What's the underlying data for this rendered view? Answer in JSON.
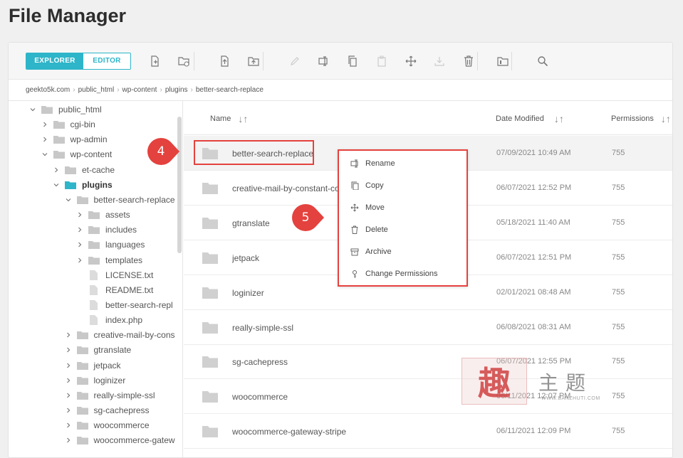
{
  "page": {
    "title": "File Manager"
  },
  "toolbar": {
    "explorer_label": "EXPLORER",
    "editor_label": "EDITOR",
    "accent": "#2eb5c9",
    "icons": [
      "new-file-icon",
      "new-folder-icon",
      "upload-file-icon",
      "upload-folder-icon",
      "edit-icon",
      "rename-icon",
      "copy-icon",
      "paste-icon",
      "move-icon",
      "extract-icon",
      "delete-icon",
      "archive-folder-icon",
      "search-icon"
    ]
  },
  "breadcrumb": [
    "geekto5k.com",
    "public_html",
    "wp-content",
    "plugins",
    "better-search-replace"
  ],
  "tree": [
    {
      "label": "public_html",
      "type": "folder",
      "depth": 0,
      "expanded": true
    },
    {
      "label": "cgi-bin",
      "type": "folder",
      "depth": 1,
      "expanded": false
    },
    {
      "label": "wp-admin",
      "type": "folder",
      "depth": 1,
      "expanded": false
    },
    {
      "label": "wp-content",
      "type": "folder",
      "depth": 1,
      "expanded": true
    },
    {
      "label": "et-cache",
      "type": "folder",
      "depth": 2,
      "expanded": false
    },
    {
      "label": "plugins",
      "type": "folder",
      "depth": 2,
      "expanded": true,
      "active": true
    },
    {
      "label": "better-search-replace",
      "type": "folder",
      "depth": 3,
      "expanded": true
    },
    {
      "label": "assets",
      "type": "folder",
      "depth": 4,
      "expanded": false
    },
    {
      "label": "includes",
      "type": "folder",
      "depth": 4,
      "expanded": false
    },
    {
      "label": "languages",
      "type": "folder",
      "depth": 4,
      "expanded": false
    },
    {
      "label": "templates",
      "type": "folder",
      "depth": 4,
      "expanded": false
    },
    {
      "label": "LICENSE.txt",
      "type": "file",
      "depth": 4
    },
    {
      "label": "README.txt",
      "type": "file",
      "depth": 4
    },
    {
      "label": "better-search-repl",
      "type": "file",
      "depth": 4
    },
    {
      "label": "index.php",
      "type": "file",
      "depth": 4
    },
    {
      "label": "creative-mail-by-cons",
      "type": "folder",
      "depth": 3,
      "expanded": false
    },
    {
      "label": "gtranslate",
      "type": "folder",
      "depth": 3,
      "expanded": false
    },
    {
      "label": "jetpack",
      "type": "folder",
      "depth": 3,
      "expanded": false
    },
    {
      "label": "loginizer",
      "type": "folder",
      "depth": 3,
      "expanded": false
    },
    {
      "label": "really-simple-ssl",
      "type": "folder",
      "depth": 3,
      "expanded": false
    },
    {
      "label": "sg-cachepress",
      "type": "folder",
      "depth": 3,
      "expanded": false
    },
    {
      "label": "woocommerce",
      "type": "folder",
      "depth": 3,
      "expanded": false
    },
    {
      "label": "woocommerce-gatew",
      "type": "folder",
      "depth": 3,
      "expanded": false
    }
  ],
  "columns": {
    "name": "Name",
    "date": "Date Modified",
    "perm": "Permissions"
  },
  "rows": [
    {
      "name": "better-search-replace",
      "date": "07/09/2021 10:49 AM",
      "perm": "755",
      "selected": true
    },
    {
      "name": "creative-mail-by-constant-contact",
      "date": "06/07/2021 12:52 PM",
      "perm": "755"
    },
    {
      "name": "gtranslate",
      "date": "05/18/2021 11:40 AM",
      "perm": "755"
    },
    {
      "name": "jetpack",
      "date": "06/07/2021 12:51 PM",
      "perm": "755"
    },
    {
      "name": "loginizer",
      "date": "02/01/2021 08:48 AM",
      "perm": "755"
    },
    {
      "name": "really-simple-ssl",
      "date": "06/08/2021 08:31 AM",
      "perm": "755"
    },
    {
      "name": "sg-cachepress",
      "date": "06/07/2021 12:55 PM",
      "perm": "755"
    },
    {
      "name": "woocommerce",
      "date": "06/11/2021 12:07 PM",
      "perm": "755"
    },
    {
      "name": "woocommerce-gateway-stripe",
      "date": "06/11/2021 12:09 PM",
      "perm": "755"
    }
  ],
  "context_menu": [
    {
      "label": "Rename",
      "icon": "rename-icon"
    },
    {
      "label": "Copy",
      "icon": "copy-icon"
    },
    {
      "label": "Move",
      "icon": "move-icon"
    },
    {
      "label": "Delete",
      "icon": "delete-icon"
    },
    {
      "label": "Archive",
      "icon": "archive-icon"
    },
    {
      "label": "Change Permissions",
      "icon": "key-icon"
    }
  ],
  "callouts": {
    "step4": "4",
    "step5": "5",
    "color": "#e4423e"
  },
  "watermark": {
    "mark": "趣",
    "text": "主题",
    "url": "WWW.BANZHUTI.COM"
  }
}
